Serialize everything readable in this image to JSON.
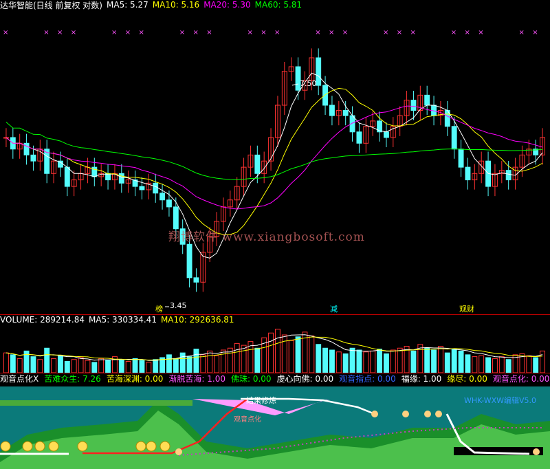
{
  "main_header": {
    "title": "达华智能(日线 前复权 对数)",
    "ma5": "MA5: 5.27",
    "ma10": "MA10: 5.16",
    "ma20": "MA20: 5.30",
    "ma60": "MA60: 5.81"
  },
  "volume_header": {
    "label": "VOLUME: 289214.84",
    "ma5": "MA5: 330334.41",
    "ma10": "MA10: 292636.81"
  },
  "indicator_header": {
    "name": "观音点化X",
    "items": [
      {
        "label": "苦难众生:",
        "value": "7.26",
        "color": "#00ff00"
      },
      {
        "label": "苦海深渊:",
        "value": "0.00",
        "color": "#ffff00"
      },
      {
        "label": "渐脱苦海:",
        "value": "1.00",
        "color": "#ff55ff"
      },
      {
        "label": "佛珠:",
        "value": "0.00",
        "color": "#00ff00"
      },
      {
        "label": "虔心向佛:",
        "value": "0.00",
        "color": "#ffffff"
      },
      {
        "label": "观音指点:",
        "value": "0.00",
        "color": "#3366ff"
      },
      {
        "label": "福缘:",
        "value": "1.00",
        "color": "#ffffff"
      },
      {
        "label": "缘尽:",
        "value": "0.00",
        "color": "#ffff00"
      },
      {
        "label": "观音点化:",
        "value": "0.00",
        "color": "#ff55ff"
      }
    ],
    "cut": "观"
  },
  "annotations": {
    "high_price": "7.50",
    "low_price": "3.45",
    "tag_bang": "榜",
    "tag_jian": "减",
    "tag_guancai": "观财",
    "watermark": "翔博软件 www.xiangbosoft.com",
    "cut_label": "结果修炼",
    "small_label": "观音点化",
    "version": "WHK-WXW编辑V5.0"
  },
  "colors": {
    "up": "#ff3232",
    "down": "#54fcfc",
    "ma5": "#ffffff",
    "ma10": "#ffff00",
    "ma20": "#ff00ff",
    "ma60": "#00ff00",
    "marker": "#ff55ff"
  },
  "chart_data": [
    {
      "type": "candlestick",
      "title": "达华智能(日线 前复权 对数)",
      "y_scale": "log",
      "ylim": [
        3.3,
        8.2
      ],
      "annotations": [
        {
          "label": "7.50",
          "kind": "high"
        },
        {
          "label": "3.45",
          "kind": "low"
        }
      ],
      "close": [
        5.6,
        5.4,
        5.5,
        5.3,
        5.2,
        5.4,
        5.0,
        5.2,
        5.1,
        4.8,
        4.9,
        5.0,
        5.1,
        4.95,
        5.0,
        4.9,
        5.0,
        4.85,
        4.9,
        4.8,
        4.75,
        4.85,
        4.7,
        4.6,
        4.5,
        4.2,
        4.0,
        3.6,
        3.55,
        3.9,
        4.1,
        4.3,
        4.5,
        4.6,
        4.8,
        5.1,
        5.3,
        5.0,
        5.2,
        5.6,
        6.2,
        6.9,
        7.0,
        6.5,
        6.7,
        7.2,
        6.6,
        6.2,
        6.0,
        6.1,
        6.0,
        5.7,
        5.5,
        5.8,
        5.9,
        5.7,
        5.6,
        5.8,
        6.0,
        6.3,
        6.1,
        6.4,
        6.2,
        6.0,
        6.1,
        5.8,
        5.4,
        5.1,
        4.9,
        5.0,
        5.2,
        4.8,
        5.0,
        5.05,
        4.9,
        5.1,
        5.3,
        5.4,
        5.3,
        5.6
      ]
    },
    {
      "type": "bar",
      "title": "VOLUME",
      "values": [
        210,
        190,
        150,
        230,
        170,
        140,
        260,
        150,
        180,
        120,
        140,
        160,
        130,
        110,
        150,
        130,
        170,
        140,
        120,
        150,
        130,
        110,
        140,
        160,
        190,
        150,
        210,
        170,
        250,
        190,
        230,
        180,
        240,
        260,
        310,
        290,
        330,
        260,
        370,
        420,
        460,
        400,
        340,
        380,
        430,
        390,
        300,
        260,
        240,
        220,
        200,
        260,
        240,
        220,
        230,
        250,
        200,
        240,
        260,
        280,
        230,
        300,
        260,
        240,
        280,
        210,
        250,
        230,
        190,
        170,
        180,
        160,
        150,
        170,
        140,
        190,
        200,
        180,
        160,
        230
      ]
    }
  ]
}
